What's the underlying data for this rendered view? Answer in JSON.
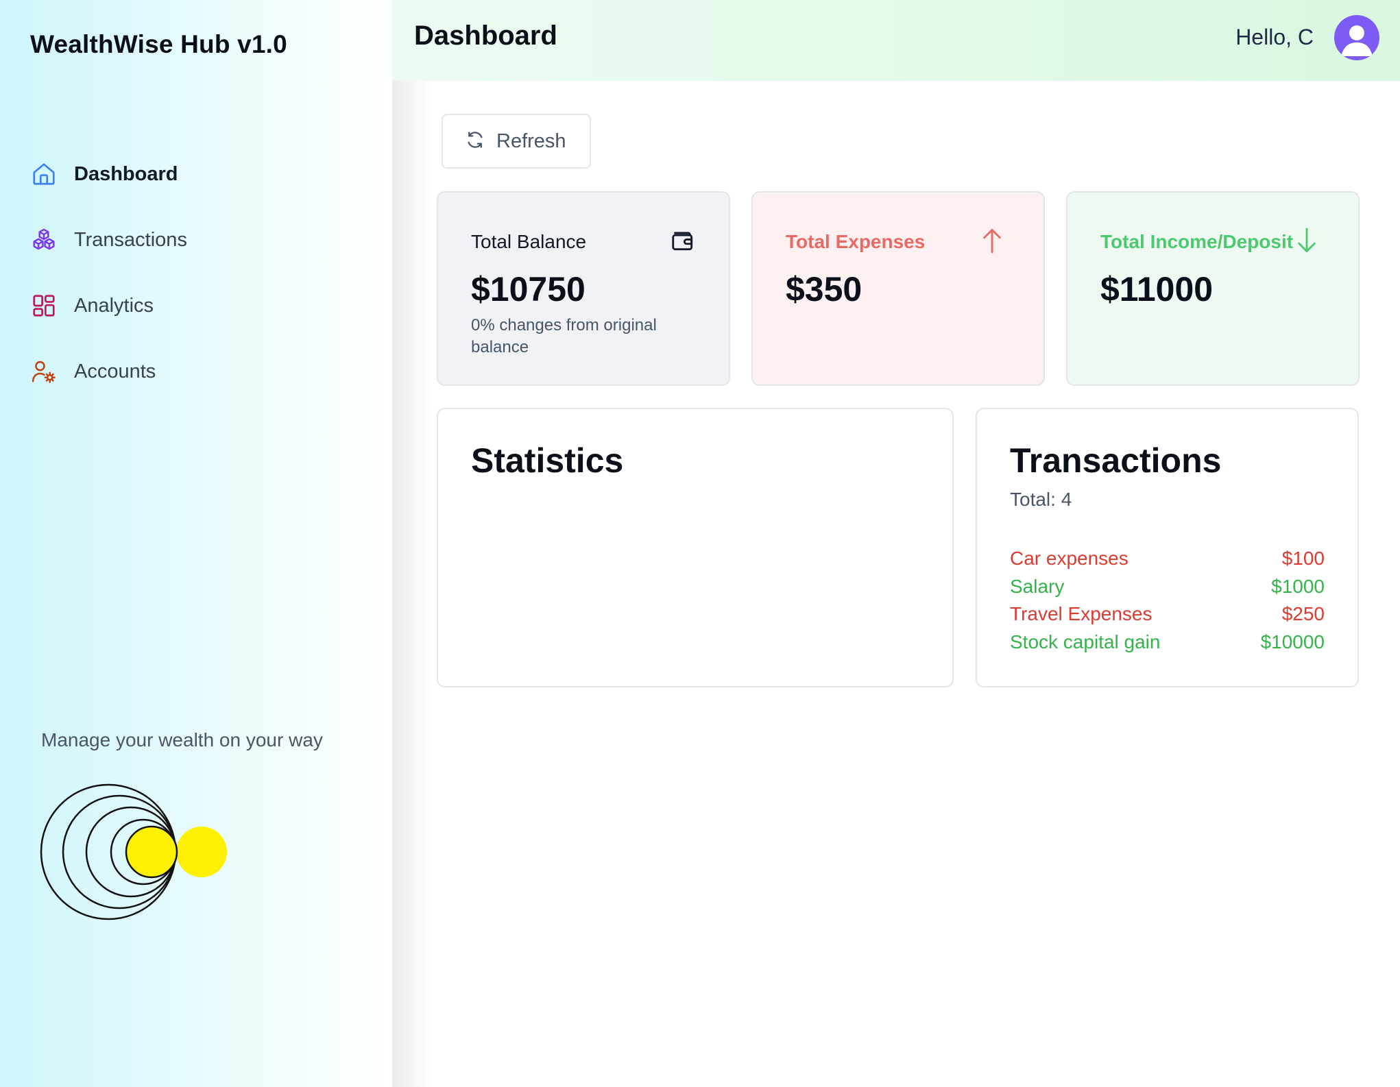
{
  "app": {
    "brand": "WealthWise Hub v1.0"
  },
  "sidebar": {
    "items": [
      {
        "label": "Dashboard",
        "icon": "home-icon",
        "color": "#3b82f6",
        "active": true
      },
      {
        "label": "Transactions",
        "icon": "cubes-icon",
        "color": "#7c3aed",
        "active": false
      },
      {
        "label": "Analytics",
        "icon": "grid-icon",
        "color": "#be185d",
        "active": false
      },
      {
        "label": "Accounts",
        "icon": "user-cog-icon",
        "color": "#c2410c",
        "active": false
      }
    ],
    "tagline": "Manage your wealth on your way"
  },
  "header": {
    "title": "Dashboard",
    "greeting": "Hello, C"
  },
  "toolbar": {
    "refresh_label": "Refresh"
  },
  "cards": {
    "balance": {
      "title": "Total Balance",
      "value": "$10750",
      "note": "0% changes from original balance",
      "icon": "wallet-icon",
      "color": "#111827",
      "bg": "#f1f2f6"
    },
    "expenses": {
      "title": "Total Expenses",
      "value": "$350",
      "icon": "arrow-up-icon",
      "color": "#e86a64",
      "bg": "#fcf0f1"
    },
    "income": {
      "title": "Total Income/Deposit",
      "value": "$11000",
      "icon": "arrow-down-icon",
      "color": "#4cc86f",
      "bg": "#eefaf1"
    }
  },
  "statistics": {
    "title": "Statistics"
  },
  "transactions": {
    "title": "Transactions",
    "total": "Total: 4",
    "items": [
      {
        "name": "Car expenses",
        "amount": "$100",
        "type": "expense"
      },
      {
        "name": "Salary",
        "amount": "$1000",
        "type": "income"
      },
      {
        "name": "Travel Expenses",
        "amount": "$250",
        "type": "expense"
      },
      {
        "name": "Stock capital gain",
        "amount": "$10000",
        "type": "income"
      }
    ],
    "colors": {
      "expense": "#dc3b30",
      "income": "#34b34a"
    }
  }
}
